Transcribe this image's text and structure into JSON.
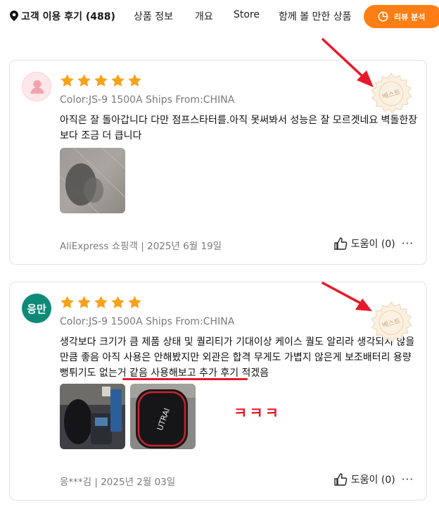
{
  "nav": {
    "title": "고객 이용 후기 (488)",
    "tabs": [
      "상품 정보",
      "개요",
      "Store",
      "함께 볼 만한 상품"
    ],
    "review_button": "리뷰 분석"
  },
  "reviews": [
    {
      "avatar": "",
      "rating": 5,
      "variant": "Color:JS-9 1500A Ships From:CHINA",
      "text": "아직은 잘 돌아갑니다 다만 점프스타터를.아직 못써봐서 성능은 잘 모르겟네요 벽돌한장보다 조금 더 큽니다",
      "meta": "AliExpress 쇼핑객 | 2025년 6월 19일",
      "helpful": "도움이 (0)",
      "badge": "베스트"
    },
    {
      "avatar": "응만",
      "rating": 5,
      "variant": "Color:JS-9 1500A Ships From:CHINA",
      "text": "생각보다 크기가 큼 제품 상태 및 퀄리티가 기대이상 케이스 퀄도 알리라 생각되지 않을만큼 좋음 아직 사용은 안해봤지만 외관은 합격 무게도 가볍지 않은게 보조배터리 용량 뻥튀기도 없는거 같음 사용해보고 추가 후기 적겠음",
      "meta": "응***김 | 2025년 2월 03일",
      "helpful": "도움이 (0)",
      "badge": "베스트",
      "annotation": "ㅋㅋㅋ"
    }
  ],
  "colors": {
    "accent": "#fd7e14",
    "star": "#f7a21a",
    "annotation_red": "#e8192c",
    "avatar_green": "#0f8a78"
  }
}
